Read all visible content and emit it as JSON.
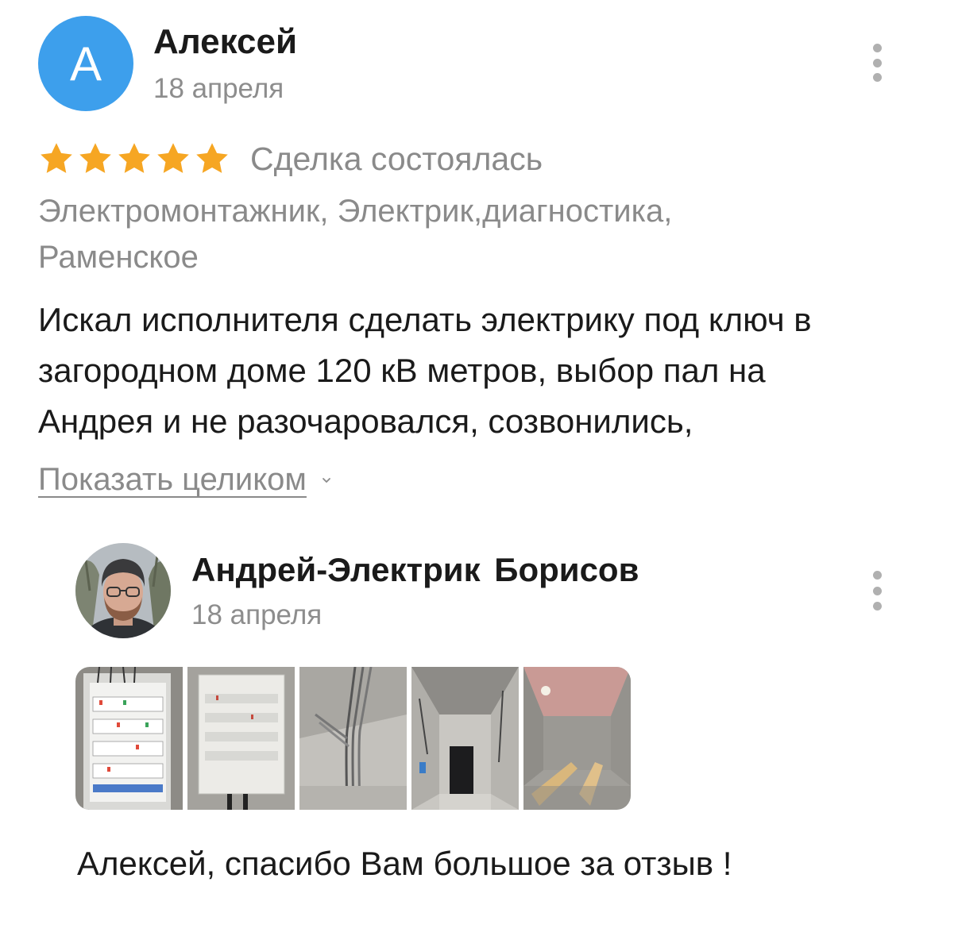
{
  "review": {
    "avatar_letter": "А",
    "author": "Алексей",
    "date": "18 апреля",
    "rating": 5,
    "rating_max": 5,
    "deal_status": "Сделка состоялась",
    "services": "Электромонтажник, Электрик,диагностика,",
    "location": "Раменское",
    "text_lines": [
      "Искал исполнителя сделать электрику под ключ в",
      "загородном доме 120 кВ метров, выбор пал на",
      "Андрея и не разочаровался, созвонились,"
    ],
    "show_more": "Показать целиком"
  },
  "reply": {
    "author": "Андрей-Электрик Борисов",
    "date": "18 апреля",
    "photos": [
      "electrical-panel-photo",
      "breaker-box-photo",
      "ceiling-cables-photo",
      "hallway-wiring-photo",
      "room-wooden-benches-photo"
    ],
    "text": "Алексей, спасибо Вам большое за отзыв !"
  },
  "colors": {
    "avatar_bg": "#3d9fec",
    "star": "#f6a623",
    "muted_text": "#8a8a8a",
    "main_text": "#1a1a1a",
    "menu_dots": "#b0b0b0"
  },
  "icons": {
    "menu": "more-vertical-icon",
    "star": "star-icon",
    "chevron": "chevron-down-icon"
  }
}
